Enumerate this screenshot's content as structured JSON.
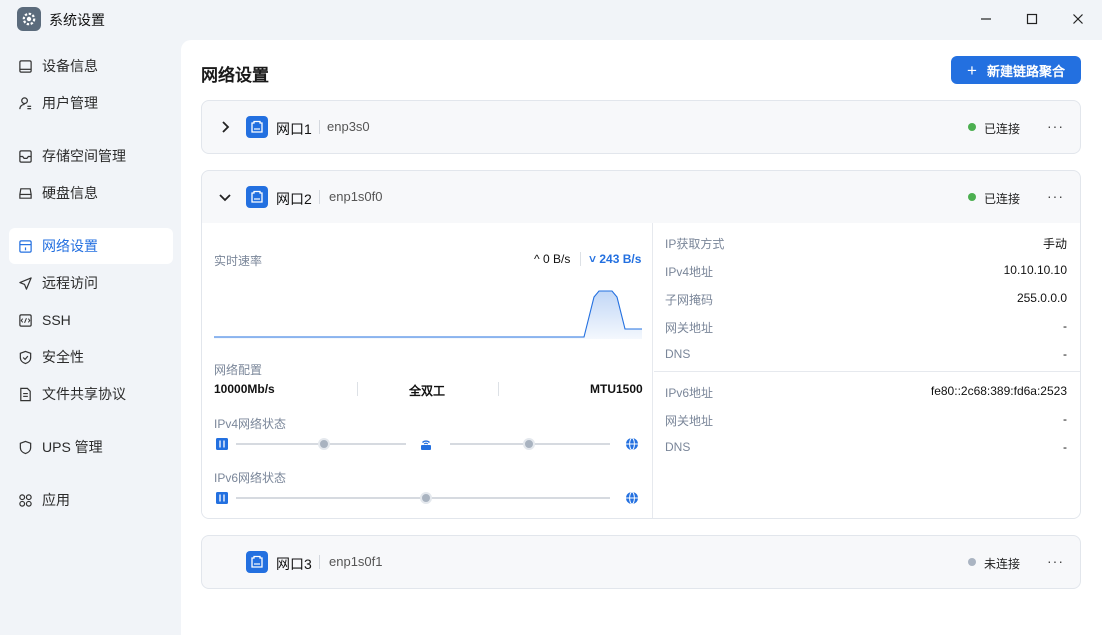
{
  "window": {
    "title": "系统设置",
    "icon": "gear-icon"
  },
  "sidebar": {
    "items": [
      {
        "label": "设备信息",
        "icon": "device-icon"
      },
      {
        "label": "用户管理",
        "icon": "user-icon"
      },
      {
        "label": "存储空间管理",
        "icon": "storage-icon"
      },
      {
        "label": "硬盘信息",
        "icon": "disk-icon"
      },
      {
        "label": "网络设置",
        "icon": "network-icon",
        "active": true
      },
      {
        "label": "远程访问",
        "icon": "send-icon"
      },
      {
        "label": "SSH",
        "icon": "terminal-icon"
      },
      {
        "label": "安全性",
        "icon": "shield-icon"
      },
      {
        "label": "文件共享协议",
        "icon": "file-icon"
      },
      {
        "label": "UPS 管理",
        "icon": "ups-icon"
      },
      {
        "label": "应用",
        "icon": "apps-icon"
      }
    ]
  },
  "main": {
    "title": "网络设置",
    "new_button": "新建链路聚合",
    "new_button_icon": "plus-icon"
  },
  "ports": [
    {
      "name": "网口1",
      "device": "enp3s0",
      "status": "已连接",
      "status_color": "#4caf50",
      "expanded": false
    },
    {
      "name": "网口2",
      "device": "enp1s0f0",
      "status": "已连接",
      "status_color": "#4caf50",
      "expanded": true
    },
    {
      "name": "网口3",
      "device": "enp1s0f1",
      "status": "未连接",
      "status_color": "#aab4c2",
      "expanded": false
    }
  ],
  "detail": {
    "speed_label": "实时速率",
    "upload": "0 B/s",
    "download": "243 B/s",
    "download_color": "#2370e0",
    "net_config_label": "网络配置",
    "link_speed": "10000Mb/s",
    "duplex": "全双工",
    "mtu": "MTU1500",
    "ipv4_state_label": "IPv4网络状态",
    "ipv6_state_label": "IPv6网络状态",
    "ipv4_rows": [
      {
        "k": "IP获取方式",
        "v": "手动"
      },
      {
        "k": "IPv4地址",
        "v": "10.10.10.10"
      },
      {
        "k": "子网掩码",
        "v": "255.0.0.0"
      },
      {
        "k": "网关地址",
        "v": "-"
      },
      {
        "k": "DNS",
        "v": "-"
      }
    ],
    "ipv6_rows": [
      {
        "k": "IPv6地址",
        "v": "fe80::2c68:389:fd6a:2523"
      },
      {
        "k": "网关地址",
        "v": "-"
      },
      {
        "k": "DNS",
        "v": "-"
      }
    ]
  }
}
